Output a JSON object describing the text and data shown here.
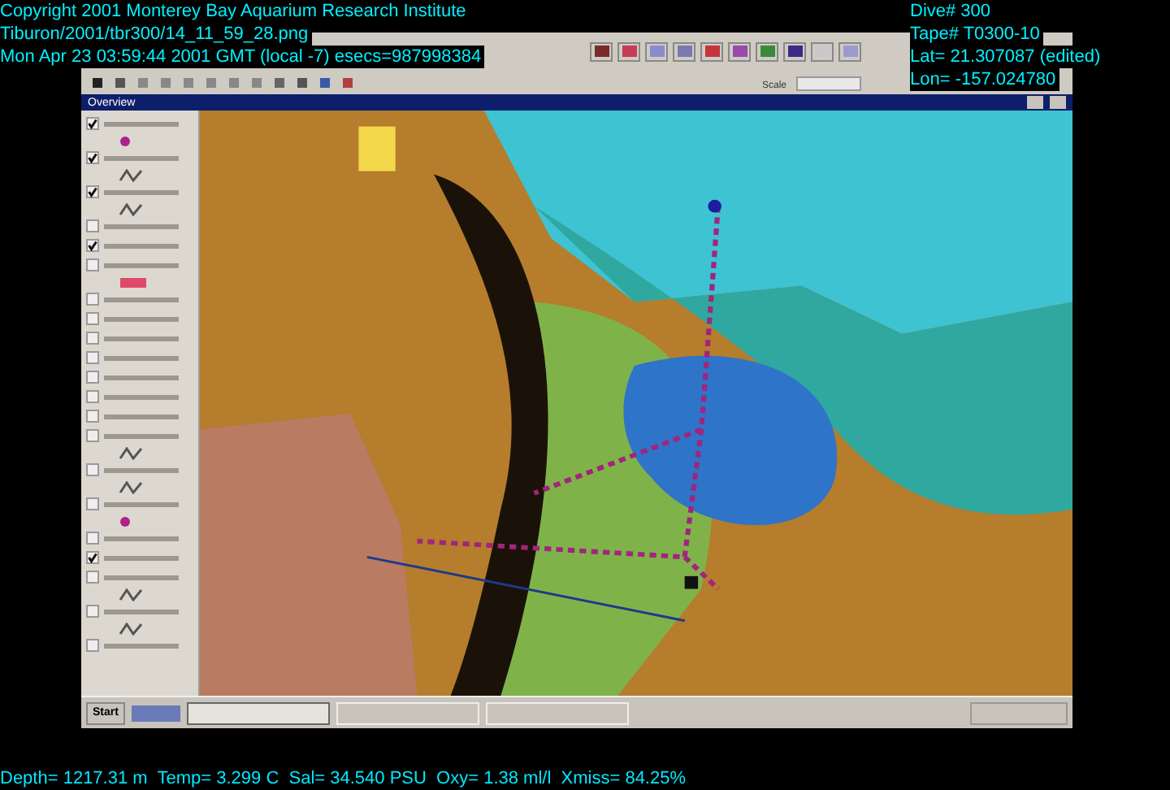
{
  "overlay": {
    "top_left": [
      "Copyright 2001 Monterey Bay Aquarium Research Institute",
      "Tiburon/2001/tbr300/14_11_59_28.png",
      "Mon Apr 23 03:59:44 2001 GMT (local -7) esecs=987998384"
    ],
    "top_right": [
      "Dive# 300",
      "Tape# T0300-10",
      "Lat= 21.307087 (edited)",
      "Lon= -157.024780"
    ],
    "bottom": "Depth= 1217.31 m  Temp= 3.299 C  Sal= 34.540 PSU  Oxy= 1.38 ml/l  Xmiss= 84.25%"
  },
  "toolbar": {
    "scale_label": "Scale"
  },
  "window": {
    "title": "Overview"
  },
  "layers": [
    {
      "checked": true,
      "kind": "point"
    },
    {
      "checked": true,
      "kind": "line"
    },
    {
      "checked": true,
      "kind": "line"
    },
    {
      "checked": false
    },
    {
      "checked": true
    },
    {
      "checked": false,
      "kind": "area"
    },
    {
      "checked": false
    },
    {
      "checked": false
    },
    {
      "checked": false
    },
    {
      "checked": false
    },
    {
      "checked": false
    },
    {
      "checked": false
    },
    {
      "checked": false
    },
    {
      "checked": false,
      "kind": "line"
    },
    {
      "checked": false,
      "kind": "line"
    },
    {
      "checked": false,
      "kind": "point"
    },
    {
      "checked": false
    },
    {
      "checked": true
    },
    {
      "checked": false,
      "kind": "line"
    },
    {
      "checked": false,
      "kind": "line"
    },
    {
      "checked": false
    }
  ],
  "taskbar": {
    "start": "Start",
    "tasks": [
      {
        "selected": true
      },
      {
        "selected": false
      },
      {
        "selected": false
      }
    ]
  }
}
